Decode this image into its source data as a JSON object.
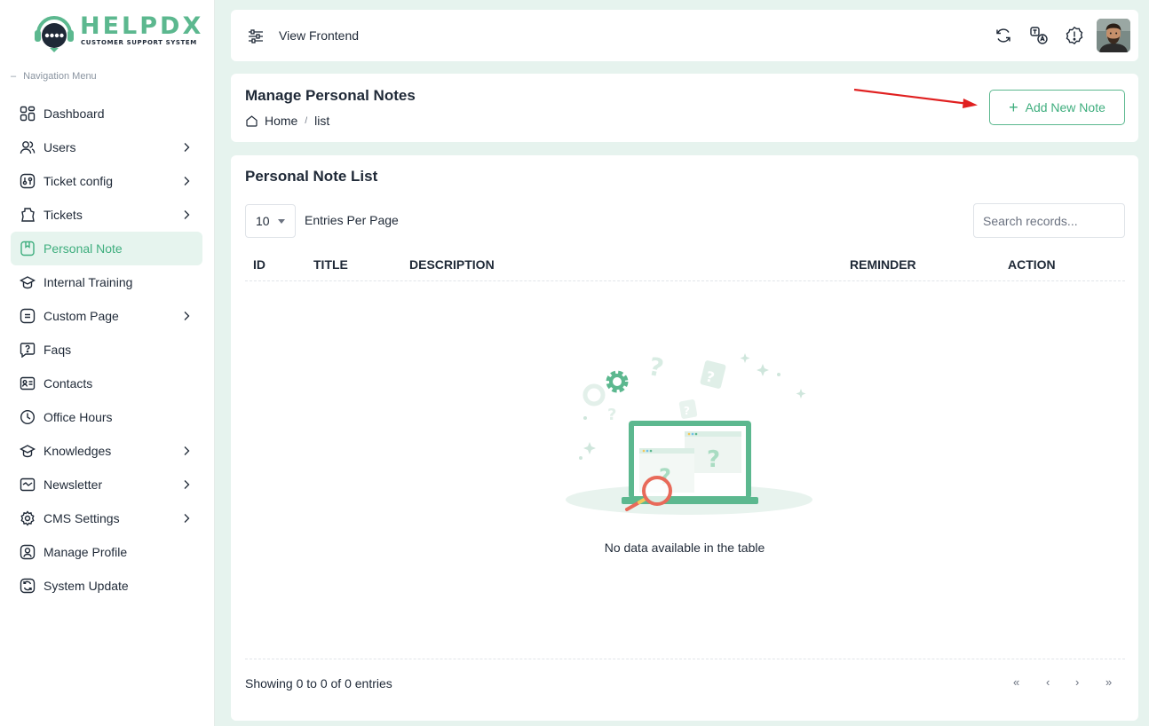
{
  "brand": {
    "name": "HELPDX",
    "tagline": "CUSTOMER SUPPORT SYSTEM",
    "accent": "#5cb88f"
  },
  "sidebar": {
    "heading": "Navigation Menu",
    "items": [
      {
        "label": "Dashboard",
        "icon": "dashboard-icon",
        "has_children": false
      },
      {
        "label": "Users",
        "icon": "users-icon",
        "has_children": true
      },
      {
        "label": "Ticket config",
        "icon": "ticket-config-icon",
        "has_children": true
      },
      {
        "label": "Tickets",
        "icon": "tickets-icon",
        "has_children": true
      },
      {
        "label": "Personal Note",
        "icon": "note-icon",
        "has_children": false,
        "active": true
      },
      {
        "label": "Internal Training",
        "icon": "graduation-cap-icon",
        "has_children": false
      },
      {
        "label": "Custom Page",
        "icon": "page-icon",
        "has_children": true
      },
      {
        "label": "Faqs",
        "icon": "question-bubble-icon",
        "has_children": false
      },
      {
        "label": "Contacts",
        "icon": "contact-card-icon",
        "has_children": false
      },
      {
        "label": "Office Hours",
        "icon": "clock-icon",
        "has_children": false
      },
      {
        "label": "Knowledges",
        "icon": "knowledge-cap-icon",
        "has_children": true
      },
      {
        "label": "Newsletter",
        "icon": "newsletter-icon",
        "has_children": true
      },
      {
        "label": "CMS Settings",
        "icon": "gear-icon",
        "has_children": true
      },
      {
        "label": "Manage Profile",
        "icon": "profile-icon",
        "has_children": false
      },
      {
        "label": "System Update",
        "icon": "refresh-icon",
        "has_children": false
      }
    ]
  },
  "topbar": {
    "view_frontend": "View Frontend",
    "icons": [
      "sync-icon",
      "translate-icon",
      "alert-icon"
    ]
  },
  "header": {
    "title": "Manage Personal Notes",
    "breadcrumb": [
      "Home",
      "list"
    ],
    "add_button": "Add New Note"
  },
  "list": {
    "title": "Personal Note List",
    "entries_value": "10",
    "entries_label": "Entries Per Page",
    "search_placeholder": "Search records...",
    "columns": [
      "ID",
      "TITLE",
      "DESCRIPTION",
      "REMINDER",
      "ACTION"
    ],
    "empty_message": "No data available in the table",
    "showing": "Showing 0 to 0 of 0 entries",
    "pager": [
      "«",
      "‹",
      "›",
      "»"
    ]
  }
}
